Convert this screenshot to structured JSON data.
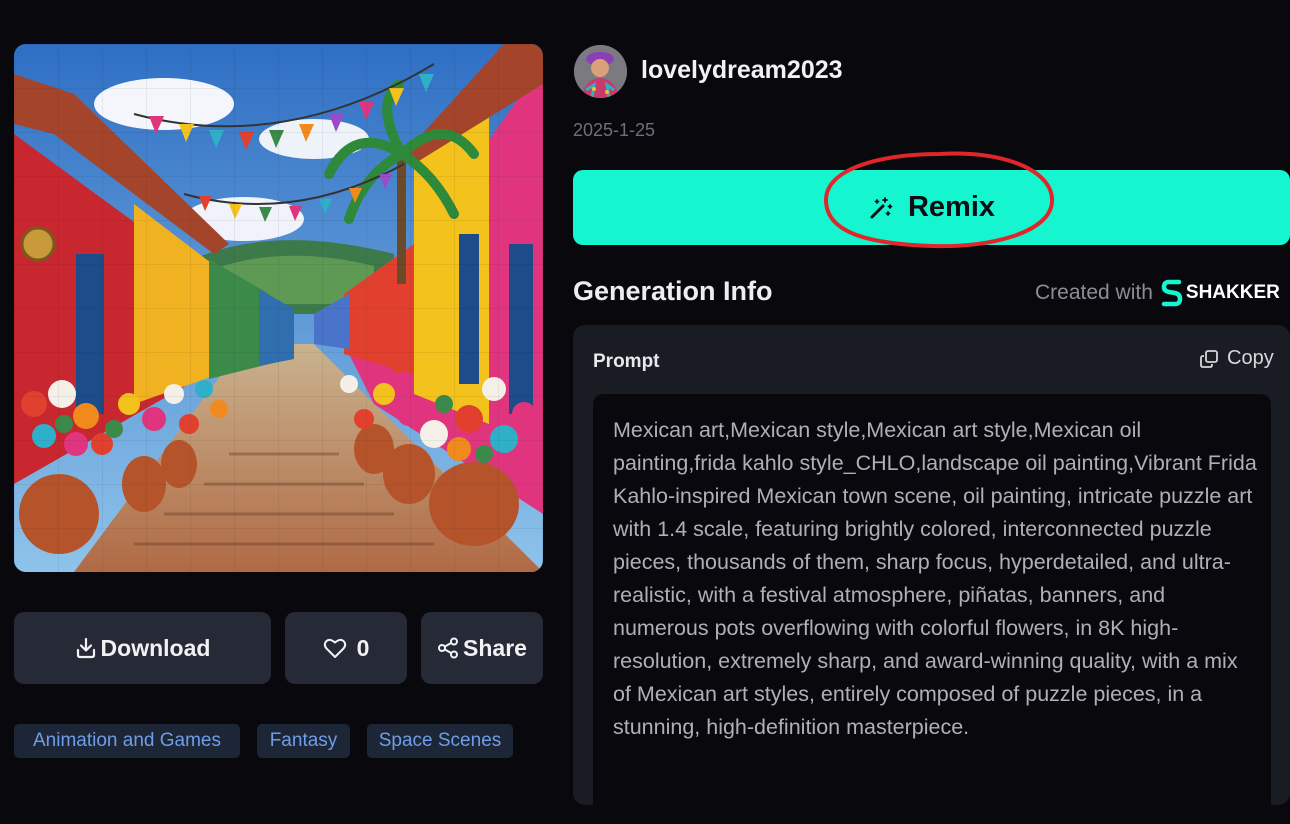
{
  "post": {
    "username": "lovelydream2023",
    "date": "2025-1-25",
    "image_alt": "Colorful Mexican town street puzzle painting"
  },
  "actions": {
    "download_label": "Download",
    "like_count": "0",
    "share_label": "Share"
  },
  "tags": [
    "Animation and Games",
    "Fantasy",
    "Space Scenes"
  ],
  "remix": {
    "label": "Remix"
  },
  "generation": {
    "title": "Generation Info",
    "created_with": "Created with",
    "brand": "SHAKKER",
    "prompt_label": "Prompt",
    "copy_label": "Copy",
    "prompt_text": "Mexican art,Mexican style,Mexican art style,Mexican oil painting,frida kahlo style_CHLO,landscape oil painting,Vibrant Frida Kahlo-inspired Mexican town scene, oil painting, intricate puzzle art with 1.4 scale, featuring brightly colored, interconnected puzzle pieces, thousands of them, sharp focus, hyperdetailed, and ultra-realistic, with a festival atmosphere, piñatas, banners, and numerous pots overflowing with colorful flowers, in 8K high-resolution, extremely sharp, and award-winning quality, with a mix of Mexican art styles, entirely composed of puzzle pieces, in a stunning, high-definition masterpiece."
  },
  "colors": {
    "background": "#09090d",
    "accent": "#14f5d0",
    "button": "#262a36",
    "tag_bg": "#1d2636",
    "tag_text": "#6f9de8",
    "annotation": "#e0262b"
  },
  "icons": [
    "download-icon",
    "heart-icon",
    "share-icon",
    "magic-wand-icon",
    "copy-icon",
    "shakker-logo-icon"
  ]
}
